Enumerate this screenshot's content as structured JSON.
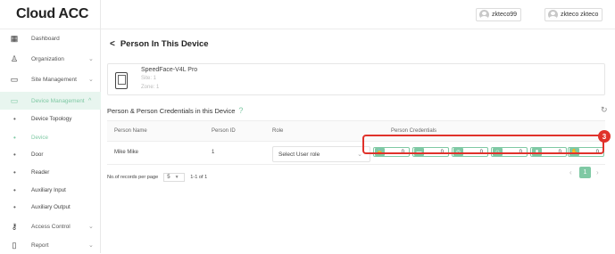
{
  "app": {
    "title": "Cloud ACC"
  },
  "topbar": {
    "users": [
      {
        "name": "zkteco99"
      },
      {
        "name": "zkteco zkteco"
      }
    ]
  },
  "sidebar": {
    "items": [
      {
        "label": "Dashboard",
        "icon": "dashboard-icon",
        "chevron": ""
      },
      {
        "label": "Organization",
        "icon": "organization-icon",
        "chevron": "⌄"
      },
      {
        "label": "Site Management",
        "icon": "site-icon",
        "chevron": "⌄"
      },
      {
        "label": "Device Management",
        "icon": "device-icon",
        "chevron": "^",
        "active": true
      },
      {
        "label": "Access Control",
        "icon": "key-icon",
        "chevron": "⌄"
      },
      {
        "label": "Report",
        "icon": "report-icon",
        "chevron": "⌄"
      }
    ],
    "subitems": [
      {
        "label": "Device Topology"
      },
      {
        "label": "Device",
        "active": true
      },
      {
        "label": "Door"
      },
      {
        "label": "Reader"
      },
      {
        "label": "Auxiliary Input"
      },
      {
        "label": "Auxiliary Output"
      }
    ]
  },
  "page": {
    "back_title": "Person In This Device",
    "back_chevron": "<"
  },
  "device": {
    "name": "SpeedFace-V4L Pro",
    "site": "Site: 1",
    "zone": "Zone: 1"
  },
  "section": {
    "title": "Person & Person Credentials in this Device",
    "help": "?"
  },
  "table": {
    "headers": [
      "Person Name",
      "Person ID",
      "Role",
      "Person Credentials"
    ],
    "rows": [
      {
        "name": "Mike Mike",
        "id": "1",
        "role": "Select User role"
      }
    ]
  },
  "credentials": [
    {
      "icon": "lock-icon",
      "glyph": "🔒",
      "count": "0"
    },
    {
      "icon": "card-icon",
      "glyph": "▬",
      "count": "0"
    },
    {
      "icon": "fingerprint-icon",
      "glyph": "◎",
      "count": "0"
    },
    {
      "icon": "face-icon",
      "glyph": "☺",
      "count": "0"
    },
    {
      "icon": "vein-icon",
      "glyph": "▮",
      "count": "0"
    },
    {
      "icon": "palm-icon",
      "glyph": "✋",
      "count": "0"
    }
  ],
  "annotation": {
    "number": "3",
    "color": "#e0322b"
  },
  "pagination": {
    "per_page_label": "No.of records per page",
    "per_page_value": "5",
    "range": "1-1 of 1",
    "current_page": "1"
  },
  "colors": {
    "accent": "#7fc9a4",
    "highlight": "#e0322b"
  }
}
